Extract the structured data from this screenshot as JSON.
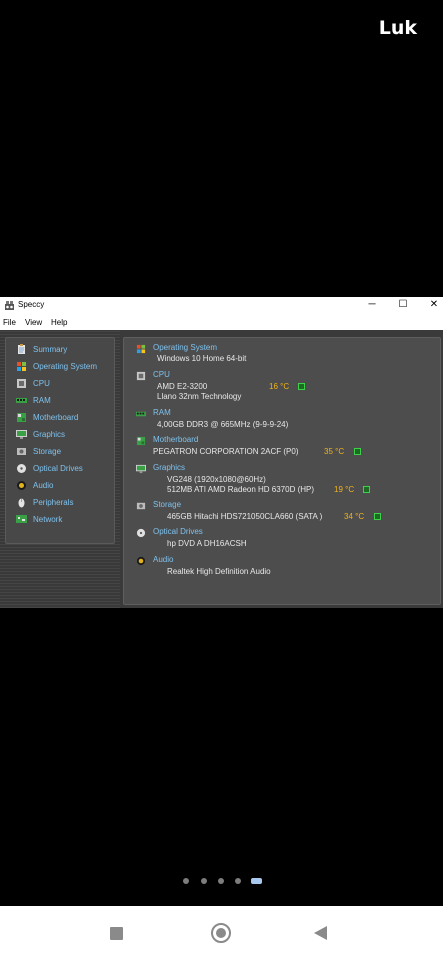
{
  "status": {
    "corner_label": "Luk"
  },
  "window": {
    "title": "Speccy",
    "menu": [
      "File",
      "View",
      "Help"
    ],
    "controls": {
      "minimize": "─",
      "maximize": "☐",
      "close": "✕"
    }
  },
  "sidebar": {
    "items": [
      {
        "label": "Summary",
        "icon": "clipboard-icon"
      },
      {
        "label": "Operating System",
        "icon": "windows-logo-icon"
      },
      {
        "label": "CPU",
        "icon": "cpu-chip-icon"
      },
      {
        "label": "RAM",
        "icon": "ram-module-icon"
      },
      {
        "label": "Motherboard",
        "icon": "motherboard-icon"
      },
      {
        "label": "Graphics",
        "icon": "monitor-icon"
      },
      {
        "label": "Storage",
        "icon": "hard-drive-icon"
      },
      {
        "label": "Optical Drives",
        "icon": "disc-icon"
      },
      {
        "label": "Audio",
        "icon": "speaker-icon"
      },
      {
        "label": "Peripherals",
        "icon": "mouse-icon"
      },
      {
        "label": "Network",
        "icon": "network-icon"
      }
    ]
  },
  "summary": {
    "os": {
      "head": "Operating System",
      "lines": [
        "Windows 10 Home 64-bit"
      ]
    },
    "cpu": {
      "head": "CPU",
      "lines": [
        "AMD E2-3200",
        "Llano 32nm Technology"
      ],
      "temp": "16 °C"
    },
    "ram": {
      "head": "RAM",
      "lines": [
        "4,00GB DDR3 @ 665MHz (9-9-9-24)"
      ]
    },
    "motherboard": {
      "head": "Motherboard",
      "lines": [
        "PEGATRON CORPORATION 2ACF (P0)"
      ],
      "temp": "35 °C"
    },
    "graphics": {
      "head": "Graphics",
      "lines": [
        "VG248 (1920x1080@60Hz)",
        "512MB ATI AMD Radeon HD 6370D (HP)"
      ],
      "temp": "19 °C"
    },
    "storage": {
      "head": "Storage",
      "lines": [
        "465GB Hitachi HDS721050CLA660 (SATA )"
      ],
      "temp": "34 °C"
    },
    "optical": {
      "head": "Optical Drives",
      "lines": [
        "hp DVD A DH16ACSH"
      ]
    },
    "audio": {
      "head": "Audio",
      "lines": [
        "Realtek High Definition Audio"
      ]
    }
  },
  "pager": {
    "count": 5,
    "active": 5
  },
  "colors": {
    "accent_text": "#7ec2ee",
    "temp_text": "#f2b21a",
    "panel_bg": "#4d4d4d"
  }
}
